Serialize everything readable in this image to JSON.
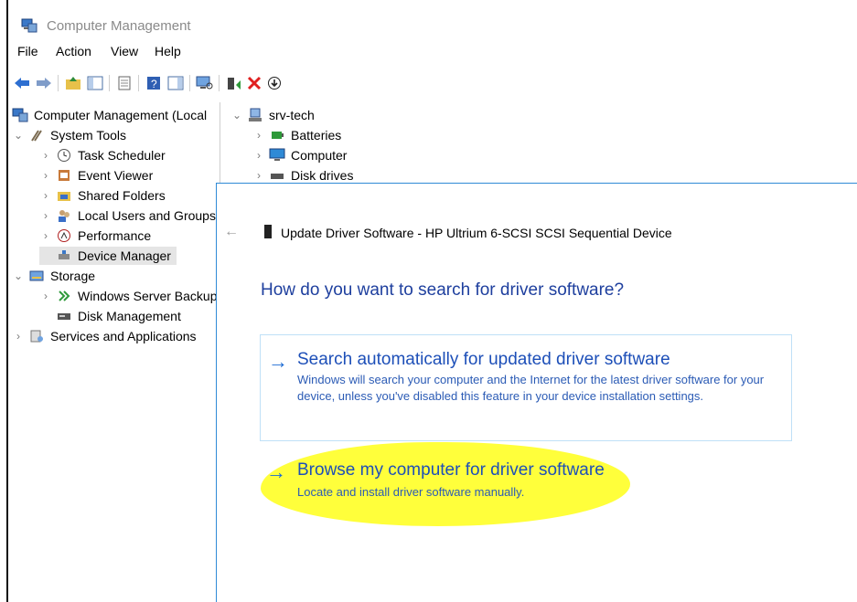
{
  "window": {
    "title": "Computer Management"
  },
  "menu": [
    "File",
    "Action",
    "View",
    "Help"
  ],
  "toolbar": [
    {
      "name": "back-icon"
    },
    {
      "name": "forward-icon"
    },
    {
      "name": "up-folder-icon"
    },
    {
      "name": "show-hide-tree-icon"
    },
    {
      "name": "properties-icon"
    },
    {
      "name": "help-icon"
    },
    {
      "name": "action-pane-icon"
    },
    {
      "name": "scan-hardware-icon"
    },
    {
      "name": "update-driver-icon"
    },
    {
      "name": "uninstall-icon"
    },
    {
      "name": "disable-device-icon"
    }
  ],
  "left_tree": {
    "root": "Computer Management (Local",
    "items": [
      {
        "label": "System Tools",
        "expand": "open",
        "icon": "system-tools-icon",
        "level": 1
      },
      {
        "label": "Task Scheduler",
        "expand": "closed",
        "icon": "task-scheduler-icon",
        "level": 2
      },
      {
        "label": "Event Viewer",
        "expand": "closed",
        "icon": "event-viewer-icon",
        "level": 2
      },
      {
        "label": "Shared Folders",
        "expand": "closed",
        "icon": "shared-folders-icon",
        "level": 2
      },
      {
        "label": "Local Users and Groups",
        "expand": "closed",
        "icon": "users-icon",
        "level": 2
      },
      {
        "label": "Performance",
        "expand": "closed",
        "icon": "performance-icon",
        "level": 2
      },
      {
        "label": "Device Manager",
        "expand": "none",
        "icon": "device-manager-icon",
        "level": 2,
        "selected": true
      },
      {
        "label": "Storage",
        "expand": "open",
        "icon": "storage-icon",
        "level": 1
      },
      {
        "label": "Windows Server Backup",
        "expand": "closed",
        "icon": "backup-icon",
        "level": 2
      },
      {
        "label": "Disk Management",
        "expand": "none",
        "icon": "disk-management-icon",
        "level": 2
      },
      {
        "label": "Services and Applications",
        "expand": "closed",
        "icon": "services-icon",
        "level": 1
      }
    ]
  },
  "right_tree": {
    "root": "srv-tech",
    "items": [
      {
        "label": "Batteries",
        "icon": "batteries-icon"
      },
      {
        "label": "Computer",
        "icon": "computer-icon"
      },
      {
        "label": "Disk drives",
        "icon": "disk-drives-icon"
      }
    ]
  },
  "dialog": {
    "back_glyph": "←",
    "title": "Update Driver Software - HP Ultrium 6-SCSI SCSI Sequential Device",
    "question": "How do you want to search for driver software?",
    "option_auto": {
      "arrow": "→",
      "heading": "Search automatically for updated driver software",
      "description": "Windows will search your computer and the Internet for the latest driver software for your device, unless you've disabled this feature in your device installation settings."
    },
    "option_browse": {
      "arrow": "→",
      "heading": "Browse my computer for driver software",
      "description": "Locate and install driver software manually."
    }
  },
  "colors": {
    "accent": "#1d4fb8",
    "highlight": "#ffff3b",
    "dialog_border": "#2f8ad6"
  }
}
